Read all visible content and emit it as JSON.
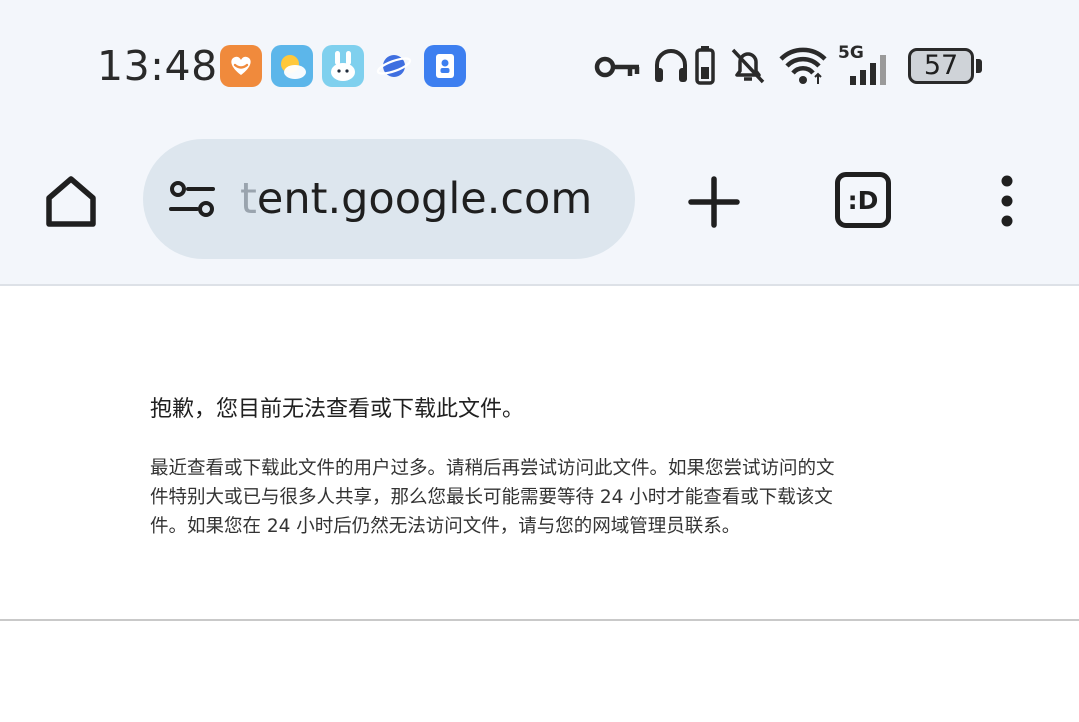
{
  "status_bar": {
    "time": "13:48",
    "network": "5G",
    "battery": "57",
    "notification_icons": [
      "health-app-icon",
      "weather-app-icon",
      "bunny-app-icon",
      "planet-app-icon",
      "contacts-app-icon"
    ],
    "system_icons": [
      "key-icon",
      "headphones-icon",
      "battery-saver-icon",
      "bell-off-icon",
      "wifi-icon",
      "signal-icon",
      "battery-icon"
    ]
  },
  "toolbar": {
    "url_faded_part": "t",
    "url_main_part": "ent.google.com",
    "tab_label": ":D",
    "icons": [
      "home-icon",
      "tune-icon",
      "plus-icon",
      "tab-switcher-icon",
      "more-vert-icon"
    ]
  },
  "page": {
    "title": "抱歉，您目前无法查看或下载此文件。",
    "body_lines": [
      "最近查看或下载此文件的用户过多。请稍后再尝试访问此文件。如果您尝试访问的文",
      "件特别大或已与很多人共享，那么您最长可能需要等待 24 小时才能查看或下载该文",
      "件。如果您在 24 小时后仍然无法访问文件，请与您的网域管理员联系。"
    ]
  },
  "colors": {
    "chrome_bg": "#f3f6fb",
    "omnibox_bg": "#dde6ee",
    "text_primary": "#1f1f1f",
    "url_fade": "#9aa4ae"
  }
}
